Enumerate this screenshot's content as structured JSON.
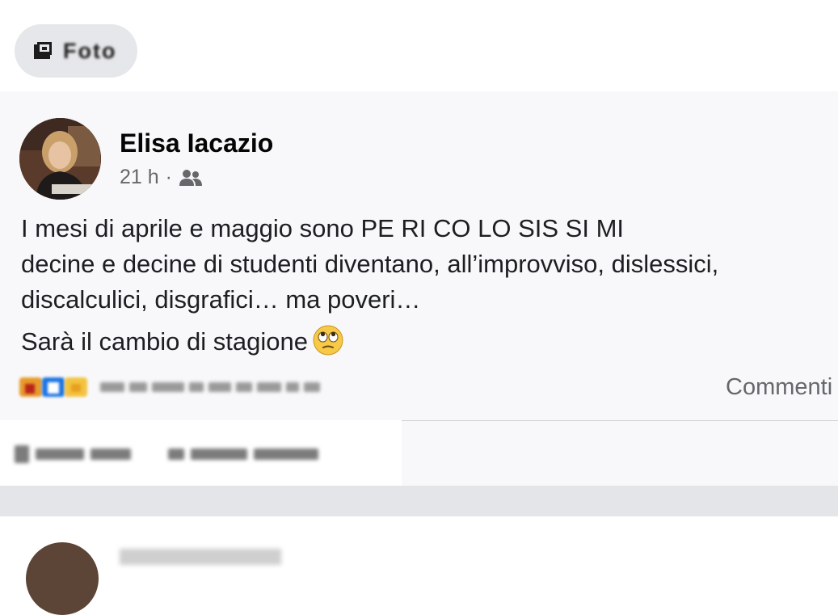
{
  "top": {
    "photo_chip_label": "Foto",
    "photo_icon": "photo-icon"
  },
  "post": {
    "author": "Elisa Iacazio",
    "time": "21 h",
    "separator": "·",
    "audience_icon": "friends-icon",
    "lines": [
      "I mesi di aprile e maggio sono PE RI CO LO SIS SI MI",
      "decine e decine di studenti diventano, all’improvviso, dislessici,",
      "discalculici, disgrafici… ma poveri…",
      "Sarà il cambio di stagione"
    ],
    "emoji": "eye-roll-emoji",
    "reaction_icons": [
      "care-reaction-icon",
      "like-reaction-icon",
      "care-reaction-icon"
    ],
    "comments_label": "Commenti"
  },
  "colors": {
    "background": "#ffffff",
    "post_background": "#f8f8fa",
    "meta": "#65676b",
    "text": "#1c1e21",
    "separator": "#e4e5e8"
  }
}
